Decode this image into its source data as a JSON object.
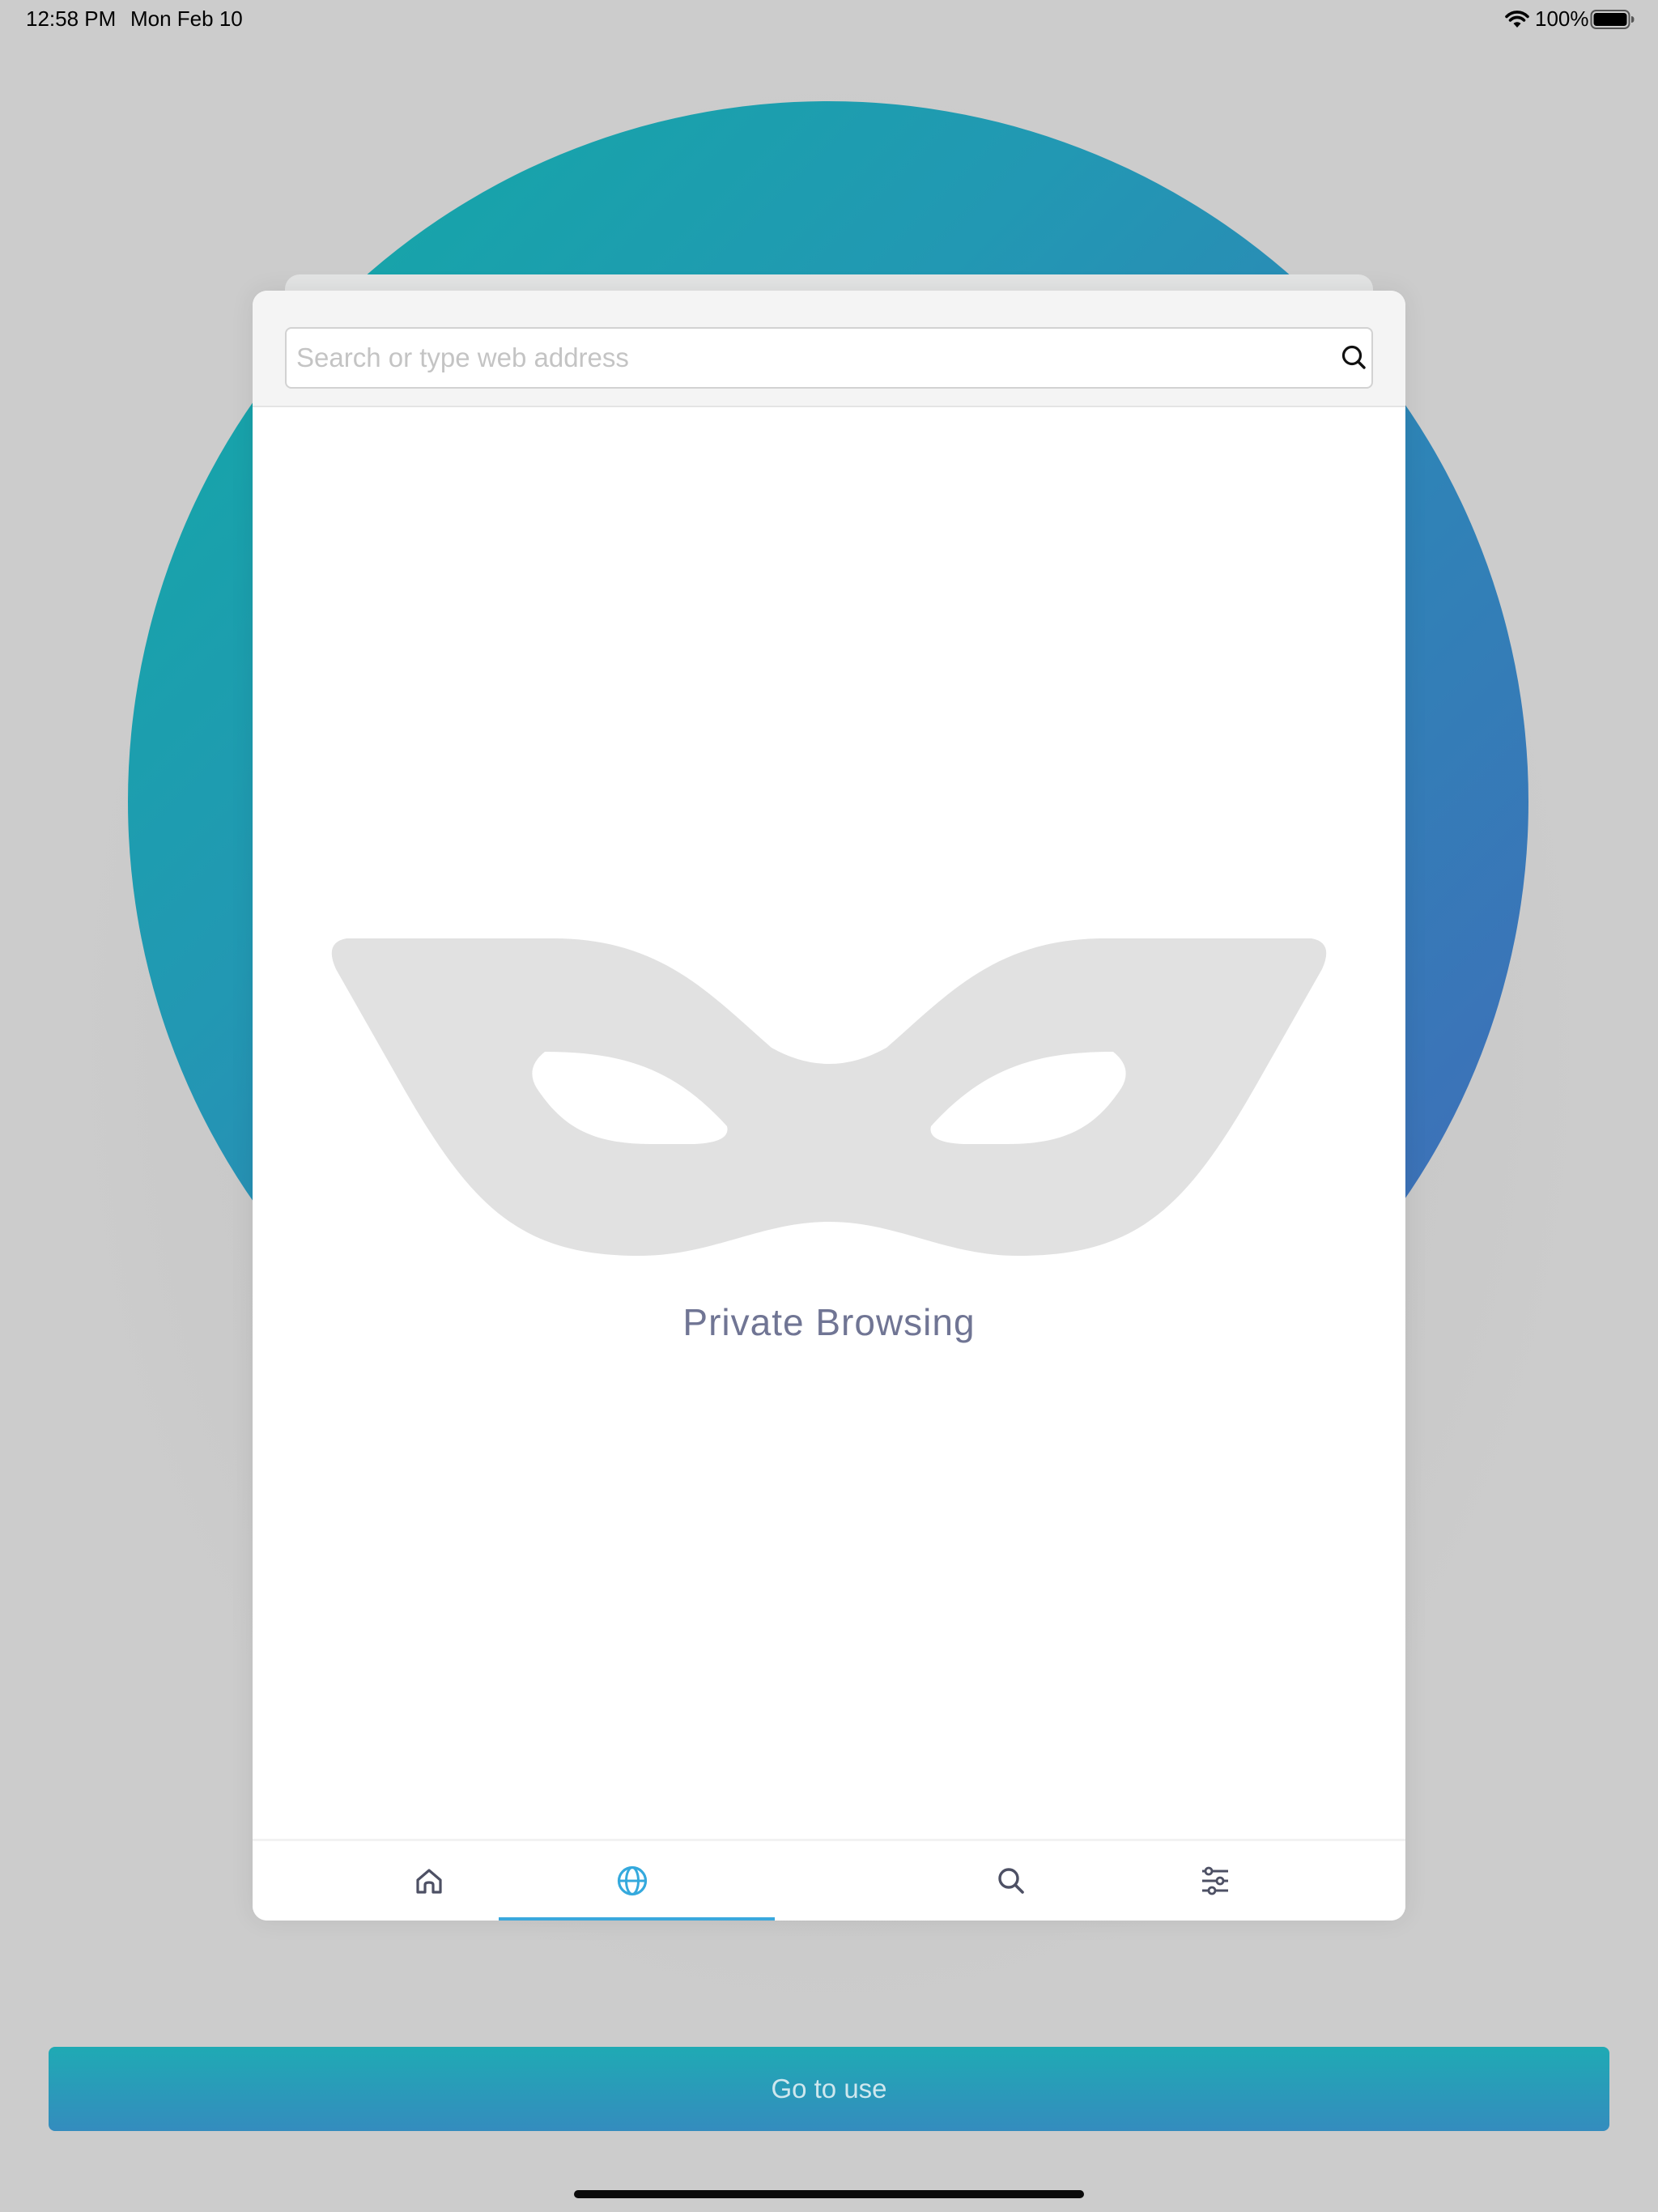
{
  "status_bar": {
    "time": "12:58 PM",
    "date": "Mon Feb 10",
    "battery_percent": "100%",
    "icons": [
      "wifi-icon",
      "battery-icon"
    ]
  },
  "browser": {
    "search": {
      "placeholder": "Search or type web address",
      "value": "",
      "button_icon": "search-icon"
    },
    "empty_state": {
      "icon": "incognito-mask-icon",
      "label": "Private Browsing"
    },
    "bottom_nav": {
      "items": [
        {
          "icon": "home-icon",
          "active": false
        },
        {
          "icon": "globe-icon",
          "active": true
        },
        {
          "icon": "search-icon",
          "active": false
        },
        {
          "icon": "sliders-icon",
          "active": false
        }
      ]
    }
  },
  "cta": {
    "label": "Go to use"
  },
  "colors": {
    "background": "#cccccc",
    "hero_gradient_start": "#10aba4",
    "hero_gradient_end": "#4468b8",
    "accent": "#3aa8dd",
    "label_text": "#707594",
    "cta_gradient_start": "#1faab4",
    "cta_gradient_end": "#348cbe"
  }
}
